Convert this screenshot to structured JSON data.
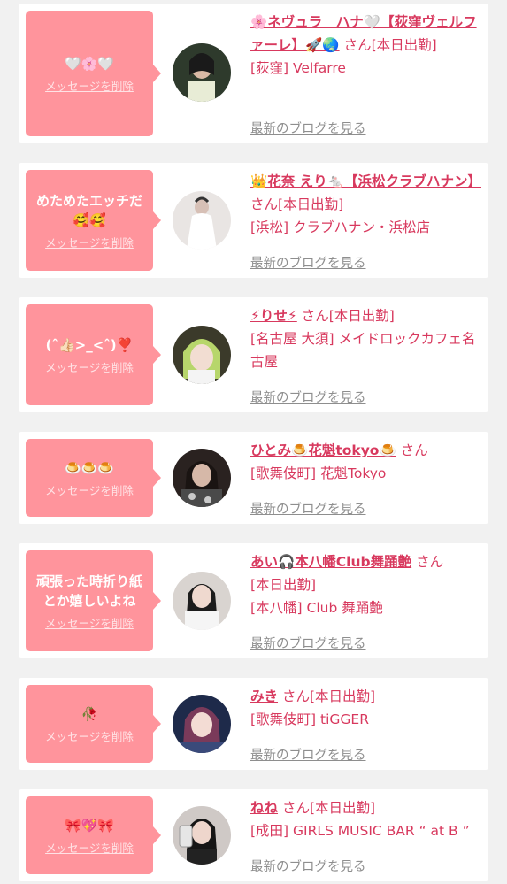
{
  "cards": [
    {
      "message": "🤍🌸🤍",
      "delete_label": "メッセージを削除",
      "name": "🌸ネヴュラ　ハナ🤍【荻窪ヴェルファーレ】🚀🌏",
      "honorific": "さん",
      "status": "[本日出勤]",
      "shop": "[荻窪] Velfarre",
      "blog_label": "最新のブログを見る"
    },
    {
      "message": "めためたエッチだ🥰🥰",
      "delete_label": "メッセージを削除",
      "name": "👑花奈 えり🐁【浜松クラブハナン】",
      "honorific": "さん",
      "status": "[本日出勤]",
      "shop": "[浜松] クラブハナン・浜松店",
      "blog_label": "最新のブログを見る"
    },
    {
      "message": "(ˆ👍🏻>_<ˆ)❣️",
      "delete_label": "メッセージを削除",
      "name": "⚡りせ⚡",
      "honorific": "さん",
      "status": "[本日出勤]",
      "shop": "[名古屋 大須] メイドロックカフェ名古屋",
      "blog_label": "最新のブログを見る"
    },
    {
      "message": "🍮🍮🍮",
      "delete_label": "メッセージを削除",
      "name": "ひとみ🍮花魁tokyo🍮",
      "honorific": "さん",
      "status": "",
      "shop": "[歌舞伎町] 花魁Tokyo",
      "blog_label": "最新のブログを見る"
    },
    {
      "message": "頑張った時折り紙とか嬉しいよね",
      "delete_label": "メッセージを削除",
      "name": "あい🎧本八幡Club舞踊艶",
      "honorific": "さん",
      "status": "[本日出勤]",
      "shop": "[本八幡] Club 舞踊艶",
      "blog_label": "最新のブログを見る"
    },
    {
      "message": "🥀",
      "delete_label": "メッセージを削除",
      "name": "みき",
      "honorific": "さん",
      "status": "[本日出勤]",
      "shop": "[歌舞伎町] tiGGER",
      "blog_label": "最新のブログを見る"
    },
    {
      "message": "🎀💖🎀",
      "delete_label": "メッセージを削除",
      "name": "ねね",
      "honorific": "さん",
      "status": "[本日出勤]",
      "shop": "[成田] GIRLS MUSIC BAR “ at B ”",
      "blog_label": "最新のブログを見る"
    }
  ],
  "colors": {
    "page_bg": "#f1f1f1",
    "card_bg": "#ffffff",
    "bubble": "#ff949c",
    "name": "#d8395e",
    "blog_link": "#8e8e8e"
  }
}
